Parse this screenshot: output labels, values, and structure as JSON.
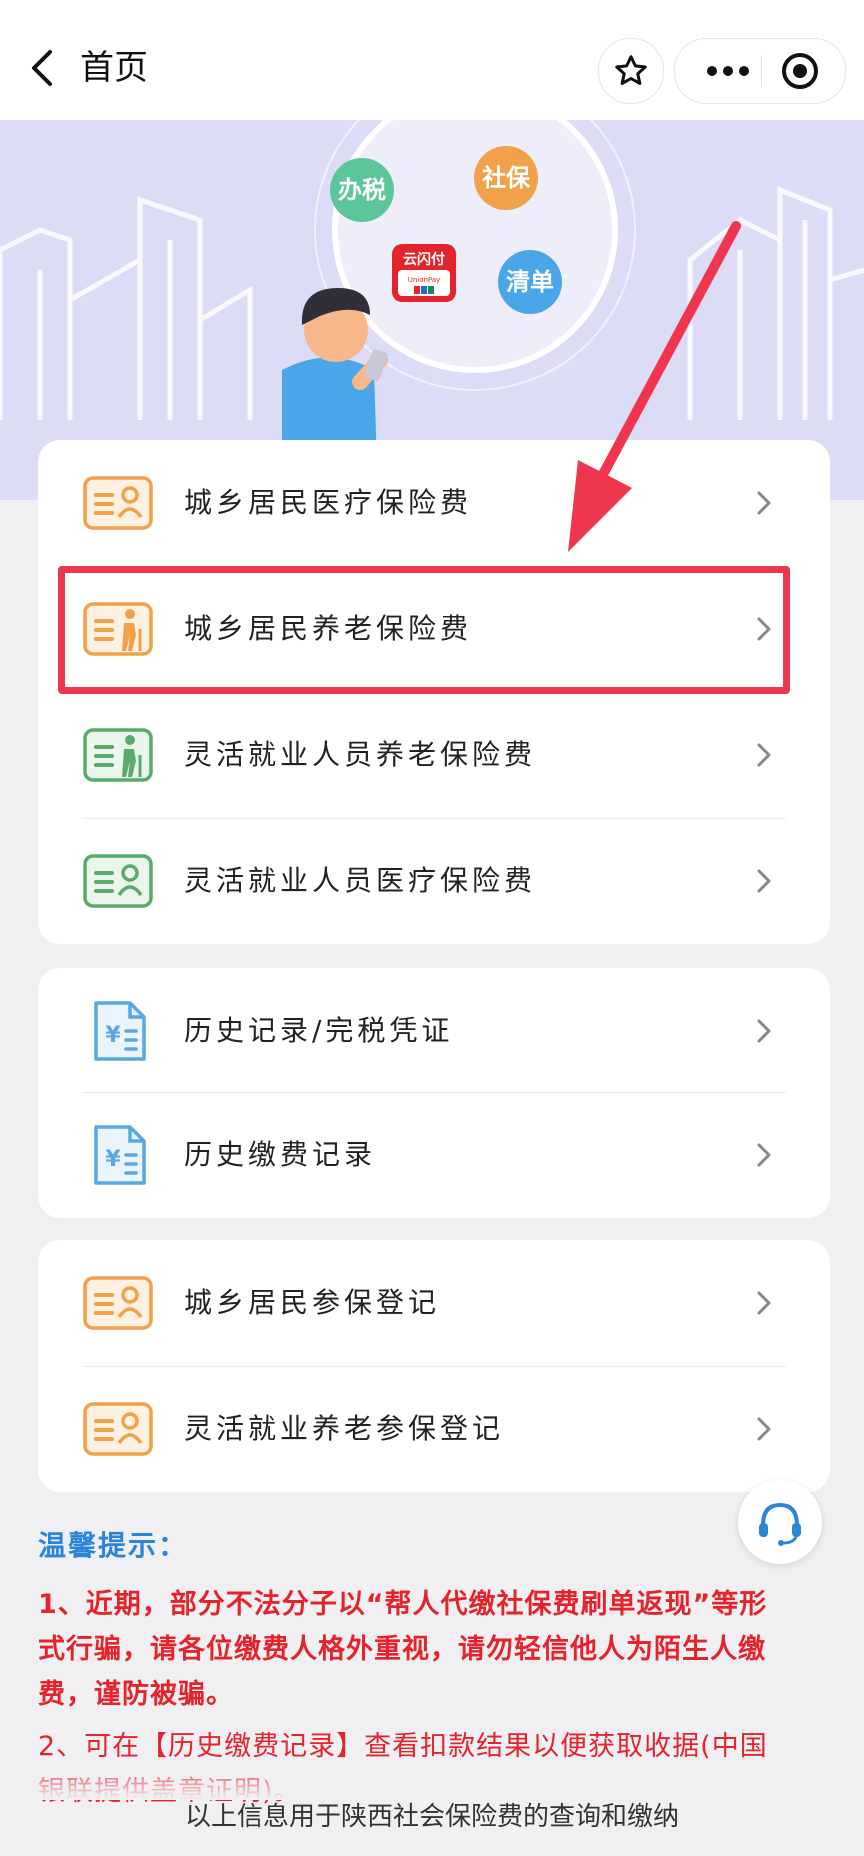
{
  "header": {
    "title": "首页"
  },
  "banner": {
    "bubbles": [
      "办税",
      "社保",
      "清单"
    ],
    "card_logo": "云闪付",
    "card_logo_sub": "UnionPay"
  },
  "services": [
    {
      "label": "城乡居民医疗保险费",
      "icon": "id-card-icon",
      "color": "#f0a14a"
    },
    {
      "label": "城乡居民养老保险费",
      "icon": "elder-card-icon",
      "color": "#f0a14a"
    },
    {
      "label": "灵活就业人员养老保险费",
      "icon": "elder-card-icon",
      "color": "#5aab6b"
    },
    {
      "label": "灵活就业人员医疗保险费",
      "icon": "id-card-icon",
      "color": "#5aab6b"
    }
  ],
  "records": [
    {
      "label": "历史记录/完税凭证",
      "icon": "receipt-icon",
      "color": "#59a9e0"
    },
    {
      "label": "历史缴费记录",
      "icon": "receipt-icon",
      "color": "#59a9e0"
    }
  ],
  "registration": [
    {
      "label": "城乡居民参保登记",
      "icon": "id-card-icon",
      "color": "#f0a14a"
    },
    {
      "label": "灵活就业养老参保登记",
      "icon": "id-card-icon",
      "color": "#f0a14a"
    }
  ],
  "notice": {
    "title": "温馨提示：",
    "line1a": "1、近期，部分不法分子以“帮人代缴社保费刷单返现”等形",
    "line1b": "式行骗，请各位缴费人格外重视，请勿轻信他人为陌生人缴",
    "line1c": "费，谨防被骗。",
    "line2a": "2、可在【历史缴费记录】查看扣款结果以便获取收据(中国",
    "line2b": "银联提供盖章证明)。"
  },
  "footer": "以上信息用于陕西社会保险费的查询和缴纳",
  "colors": {
    "highlight": "#f0364e",
    "notice_red": "#e5232d",
    "notice_blue": "#2a84d8"
  }
}
